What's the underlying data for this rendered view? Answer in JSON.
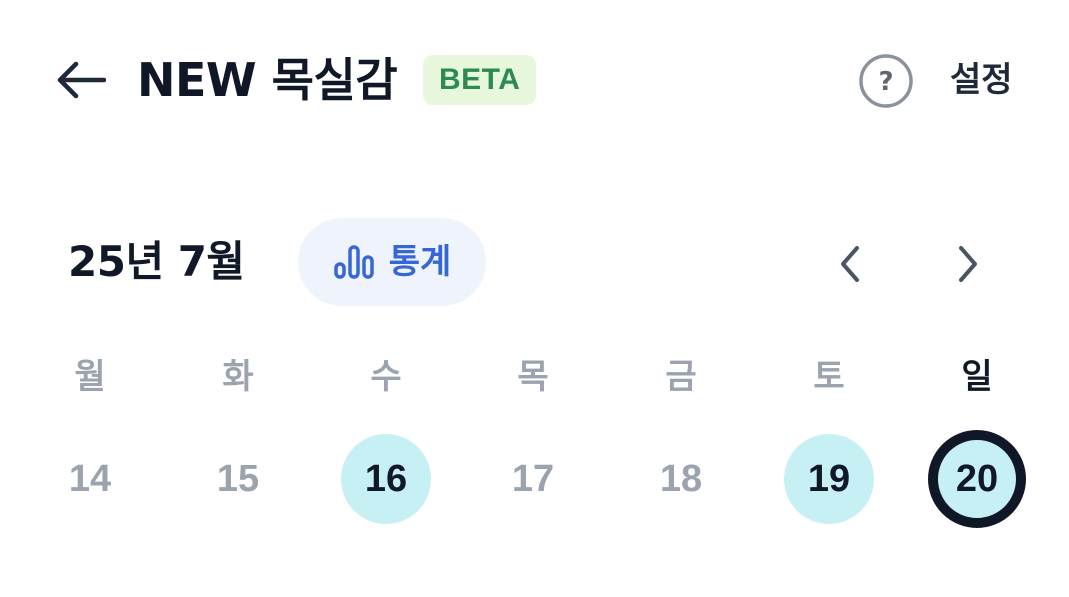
{
  "header": {
    "back_icon": "arrow-left-icon",
    "title": "NEW 목실감",
    "badge": "BETA",
    "help_icon": "question-circle-icon",
    "help_glyph": "?",
    "settings_label": "설정"
  },
  "calendar": {
    "month_label": "25년 7월",
    "stats_icon": "bar-chart-icon",
    "stats_label": "통계",
    "prev_icon": "chevron-left-icon",
    "next_icon": "chevron-right-icon",
    "weekdays": [
      "월",
      "화",
      "수",
      "목",
      "금",
      "토",
      "일"
    ],
    "days": [
      {
        "label": "14",
        "state": "default"
      },
      {
        "label": "15",
        "state": "default"
      },
      {
        "label": "16",
        "state": "marked"
      },
      {
        "label": "17",
        "state": "default"
      },
      {
        "label": "18",
        "state": "default"
      },
      {
        "label": "19",
        "state": "marked"
      },
      {
        "label": "20",
        "state": "selected"
      }
    ]
  },
  "colors": {
    "badge_bg": "#e6f7dc",
    "badge_text": "#2f8a4f",
    "stats_bg": "#eef3fc",
    "accent_blue": "#3567d6",
    "marked_day_bg": "#c6f0f3",
    "selected_ring": "#101828",
    "muted_text": "#9aa3ae"
  }
}
